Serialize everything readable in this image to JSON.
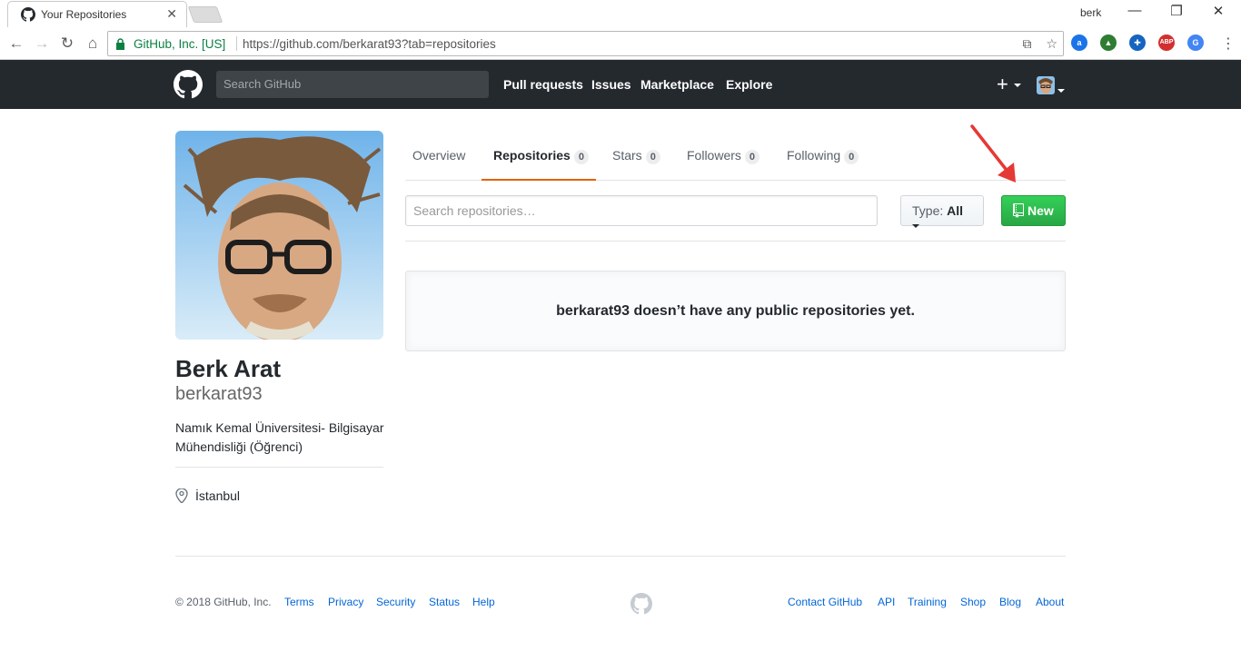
{
  "browser": {
    "tab_title": "Your Repositories",
    "tab_close": "✕",
    "profile_name": "berk",
    "window_controls": {
      "minimize": "—",
      "restore": "❐",
      "close": "✕"
    },
    "security_label": "GitHub, Inc. [US]",
    "url_host": "https://github.com",
    "url_path": "/berkarat93?tab=repositories",
    "extensions": [
      {
        "name": "a-icon",
        "label": "a",
        "color": "#1a73e8"
      },
      {
        "name": "tree-icon",
        "label": "▲",
        "color": "#2e7d32"
      },
      {
        "name": "gear-ext-icon",
        "label": "✚",
        "color": "#1565c0"
      },
      {
        "name": "adblock-plus-icon",
        "label": "ABP",
        "color": "#d32f2f"
      },
      {
        "name": "translate-icon",
        "label": "G",
        "color": "#4285f4"
      }
    ]
  },
  "header": {
    "search_placeholder": "Search GitHub",
    "nav": [
      "Pull requests",
      "Issues",
      "Marketplace",
      "Explore"
    ],
    "plus": "+"
  },
  "profile": {
    "fullname": "Berk Arat",
    "username": "berkarat93",
    "bio": "Namık Kemal Üniversitesi- Bilgisayar Mühendisliği (Öğrenci)",
    "location": "İstanbul"
  },
  "tabs": [
    {
      "label": "Overview",
      "count": null
    },
    {
      "label": "Repositories",
      "count": "0"
    },
    {
      "label": "Stars",
      "count": "0"
    },
    {
      "label": "Followers",
      "count": "0"
    },
    {
      "label": "Following",
      "count": "0"
    }
  ],
  "filters": {
    "search_placeholder": "Search repositories…",
    "type_label": "Type:",
    "type_value": "All",
    "new_button": "New"
  },
  "blankslate_message": "berkarat93 doesn’t have any public repositories yet.",
  "footer": {
    "copyright": "© 2018 GitHub, Inc.",
    "left_links": [
      "Terms",
      "Privacy",
      "Security",
      "Status",
      "Help"
    ],
    "right_links": [
      "Contact GitHub",
      "API",
      "Training",
      "Shop",
      "Blog",
      "About"
    ]
  },
  "colors": {
    "header_bg": "#24292e",
    "new_button_green": "#28a745",
    "selected_tab_underline": "#e36209",
    "link_blue": "#0366d6",
    "arrow_red": "#e53935"
  }
}
